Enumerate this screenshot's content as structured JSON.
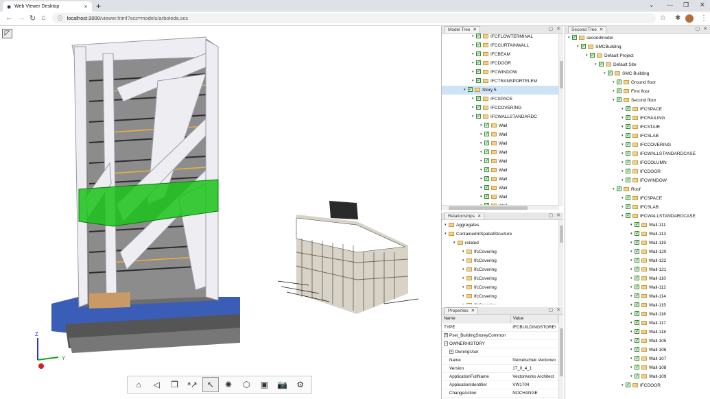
{
  "browser": {
    "tab_title": "Web Viewer Desktop",
    "url_host": "localhost:3000",
    "url_path": "/viewer.html?scs=models/arboleda.scs"
  },
  "viewer": {
    "axis_labels": {
      "z": "Z",
      "y": "Y"
    },
    "toolbar": [
      "home",
      "camera-nav",
      "cube",
      "redline",
      "select",
      "explode",
      "cutting",
      "model-view",
      "snapshot",
      "settings"
    ]
  },
  "model_tree": {
    "tab": "Model Tree",
    "rows": [
      {
        "label": "IFCFLOWTERMINAL",
        "indent": 7,
        "cb": true
      },
      {
        "label": "IFCCURTAINWALL",
        "indent": 7,
        "cb": true
      },
      {
        "label": "IFCBEAM",
        "indent": 7,
        "cb": true
      },
      {
        "label": "IFCDOOR",
        "indent": 7,
        "cb": true
      },
      {
        "label": "IFCWINDOW",
        "indent": 7,
        "cb": true
      },
      {
        "label": "IFCTRANSPORTELEM",
        "indent": 7,
        "cb": true
      },
      {
        "label": "Story 5",
        "indent": 6,
        "cb": true,
        "selected": true
      },
      {
        "label": "IFCSPACE",
        "indent": 7,
        "cb": true
      },
      {
        "label": "IFCCOVERING",
        "indent": 7,
        "cb": true
      },
      {
        "label": "IFCWALLSTANDARDC",
        "indent": 7,
        "cb": true
      },
      {
        "label": "Wall",
        "indent": 8,
        "cb": true
      },
      {
        "label": "Wall",
        "indent": 8,
        "cb": true
      },
      {
        "label": "Wall",
        "indent": 8,
        "cb": true
      },
      {
        "label": "Wall",
        "indent": 8,
        "cb": true
      },
      {
        "label": "Wall",
        "indent": 8,
        "cb": true
      },
      {
        "label": "Wall",
        "indent": 8,
        "cb": true
      },
      {
        "label": "Wall",
        "indent": 8,
        "cb": true
      },
      {
        "label": "Wall",
        "indent": 8,
        "cb": true
      },
      {
        "label": "Wall",
        "indent": 8,
        "cb": true
      },
      {
        "label": "Wall",
        "indent": 8,
        "cb": true
      }
    ]
  },
  "relationships": {
    "tab": "Relationships",
    "rows": [
      {
        "label": "Aggregates",
        "indent": 0
      },
      {
        "label": "ContainedInSpatialStructure",
        "indent": 0
      },
      {
        "label": "related",
        "indent": 1
      },
      {
        "label": "IfcCovering",
        "indent": 2
      },
      {
        "label": "IfcCovering",
        "indent": 2
      },
      {
        "label": "IfcCovering",
        "indent": 2
      },
      {
        "label": "IfcCovering",
        "indent": 2
      },
      {
        "label": "IfcCovering",
        "indent": 2
      },
      {
        "label": "IfcCovering",
        "indent": 2
      },
      {
        "label": "IfcCovering",
        "indent": 2
      }
    ]
  },
  "properties": {
    "tab": "Properties",
    "headers": [
      "Name",
      "Value"
    ],
    "rows": [
      {
        "name": "TYPE",
        "value": "IFCBUILDINGSTORE\\",
        "indent": 0
      },
      {
        "name": "Pset_BuildingStoreyCommon",
        "value": "",
        "indent": 0,
        "plus": true
      },
      {
        "name": "OWNERHISTORY",
        "value": "",
        "indent": 0,
        "minus": true
      },
      {
        "name": "OwningUser",
        "value": "",
        "indent": 1,
        "plus": true
      },
      {
        "name": "Name",
        "value": "Nemetschek Vectorwo",
        "indent": 1
      },
      {
        "name": "Version",
        "value": "17_0_4_1",
        "indent": 1
      },
      {
        "name": "ApplicationFullName",
        "value": "Vectorworks Architect",
        "indent": 1
      },
      {
        "name": "ApplicationIdentifier",
        "value": "VW1704",
        "indent": 1
      },
      {
        "name": "ChangeAction",
        "value": "NOCHANGE",
        "indent": 1
      }
    ]
  },
  "spec_tree": {
    "tab": "Second Tree",
    "rows": [
      {
        "label": "secondmodel",
        "indent": 0
      },
      {
        "label": "SMCBuilding",
        "indent": 1
      },
      {
        "label": "Default Project",
        "indent": 2
      },
      {
        "label": "Default Site",
        "indent": 3
      },
      {
        "label": "SMC Building",
        "indent": 4
      },
      {
        "label": "Ground floor",
        "indent": 5
      },
      {
        "label": "First floor",
        "indent": 5
      },
      {
        "label": "Second floor",
        "indent": 5
      },
      {
        "label": "IFCSPACE",
        "indent": 6
      },
      {
        "label": "IFCRAILING",
        "indent": 6
      },
      {
        "label": "IFCSTAIR",
        "indent": 6
      },
      {
        "label": "IFCSLAB",
        "indent": 6
      },
      {
        "label": "IFCCOVERING",
        "indent": 6
      },
      {
        "label": "IFCWALLSTANDARDCASE",
        "indent": 6
      },
      {
        "label": "IFCCOLUMN",
        "indent": 6
      },
      {
        "label": "IFCDOOR",
        "indent": 6
      },
      {
        "label": "IFCWINDOW",
        "indent": 6
      },
      {
        "label": "Roof",
        "indent": 5
      },
      {
        "label": "IFCSPACE",
        "indent": 6
      },
      {
        "label": "IFCSLAB",
        "indent": 6
      },
      {
        "label": "IFCWALLSTANDARDCASE",
        "indent": 6
      },
      {
        "label": "Wall-111",
        "indent": 7
      },
      {
        "label": "Wall-113",
        "indent": 7
      },
      {
        "label": "Wall-119",
        "indent": 7
      },
      {
        "label": "Wall-120",
        "indent": 7
      },
      {
        "label": "Wall-122",
        "indent": 7
      },
      {
        "label": "Wall-121",
        "indent": 7
      },
      {
        "label": "Wall-110",
        "indent": 7
      },
      {
        "label": "Wall-112",
        "indent": 7
      },
      {
        "label": "Wall-114",
        "indent": 7
      },
      {
        "label": "Wall-115",
        "indent": 7
      },
      {
        "label": "Wall-116",
        "indent": 7
      },
      {
        "label": "Wall-117",
        "indent": 7
      },
      {
        "label": "Wall-118",
        "indent": 7
      },
      {
        "label": "Wall-105",
        "indent": 7
      },
      {
        "label": "Wall-106",
        "indent": 7
      },
      {
        "label": "Wall-107",
        "indent": 7
      },
      {
        "label": "Wall-108",
        "indent": 7
      },
      {
        "label": "Wall-109",
        "indent": 7
      },
      {
        "label": "IFCDOOR",
        "indent": 6
      }
    ]
  }
}
